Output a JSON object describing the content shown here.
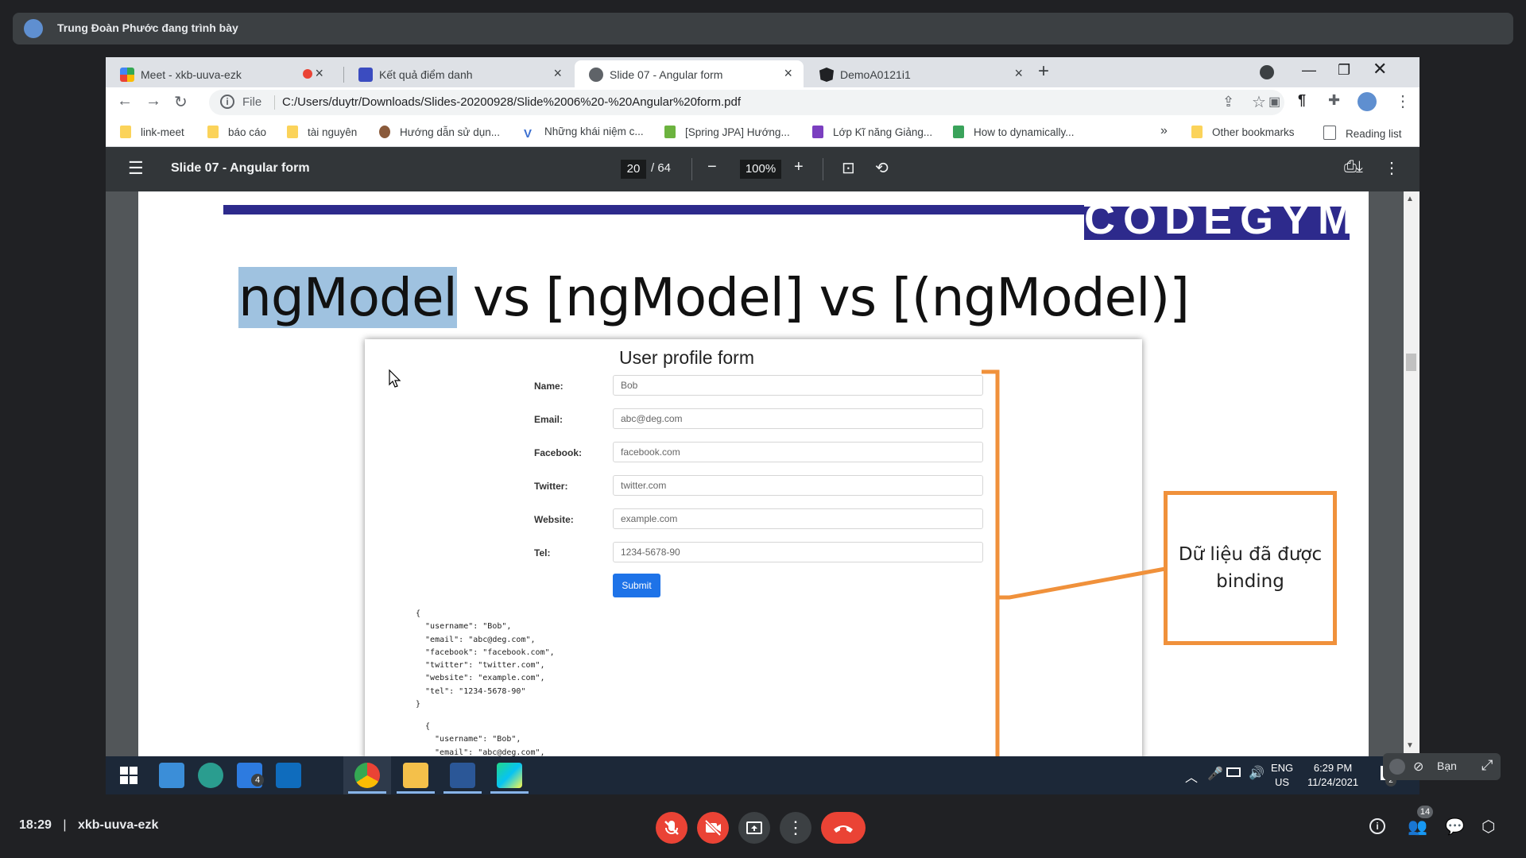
{
  "meet": {
    "presenter_banner": "Trung Đoàn Phước đang trình bày",
    "time": "18:29",
    "separator": "|",
    "meeting_code": "xkb-uuva-ezk",
    "people_count": "14",
    "self_label": "Bạn"
  },
  "browser": {
    "tabs": [
      {
        "title": "Meet - xkb-uuva-ezk"
      },
      {
        "title": "Kết quả điểm danh"
      },
      {
        "title": "Slide 07 - Angular form"
      },
      {
        "title": "DemoA0121i1"
      }
    ],
    "address": {
      "scheme_label": "File",
      "url": "C:/Users/duytr/Downloads/Slides-20200928/Slide%2006%20-%20Angular%20form.pdf"
    },
    "bookmarks": [
      "link-meet",
      "báo cáo",
      "tài nguyên",
      "Hướng dẫn sử dụn...",
      "Những khái niệm c...",
      "[Spring JPA] Hướng...",
      "Lớp Kĩ năng Giảng...",
      "How to dynamically..."
    ],
    "bookmarks_overflow": "»",
    "other_bookmarks": "Other bookmarks",
    "reading_list": "Reading list"
  },
  "pdf": {
    "title": "Slide 07 - Angular form",
    "current_page": "20",
    "total_pages": "/ 64",
    "zoom": "100%"
  },
  "slide": {
    "title_highlight": "ngModel",
    "title_rest": " vs [ngModel] vs [(ngModel)]",
    "logo_text": "CODEGYM",
    "callout": "Dữ liệu đã được binding",
    "form": {
      "title": "User profile form",
      "fields": [
        {
          "label": "Name:",
          "value": "Bob"
        },
        {
          "label": "Email:",
          "value": "abc@deg.com"
        },
        {
          "label": "Facebook:",
          "value": "facebook.com"
        },
        {
          "label": "Twitter:",
          "value": "twitter.com"
        },
        {
          "label": "Website:",
          "value": "example.com"
        },
        {
          "label": "Tel:",
          "value": "1234-5678-90"
        }
      ],
      "submit": "Submit",
      "json_block_1": "{\n  \"username\": \"Bob\",\n  \"email\": \"abc@deg.com\",\n  \"facebook\": \"facebook.com\",\n  \"twitter\": \"twitter.com\",\n  \"website\": \"example.com\",\n  \"tel\": \"1234-5678-90\"\n}",
      "json_block_2": "{\n  \"username\": \"Bob\",\n  \"email\": \"abc@deg.com\","
    }
  },
  "taskbar": {
    "todo_badge": "4",
    "lang": "ENG",
    "region": "US",
    "clock_time": "6:29 PM",
    "clock_date": "11/24/2021",
    "notif_badge": "2"
  }
}
